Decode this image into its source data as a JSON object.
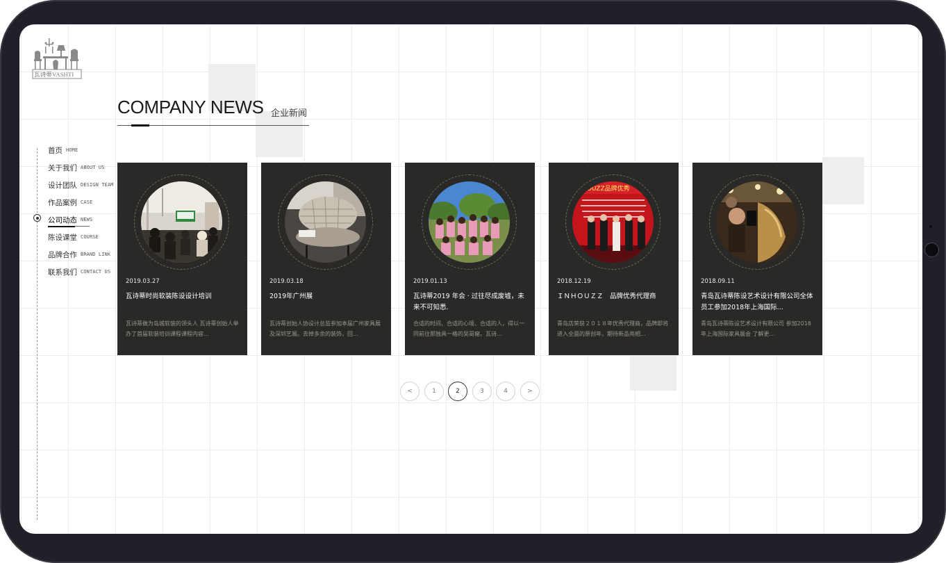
{
  "logo": {
    "brand_cn": "瓦诗蒂",
    "brand_en": "VASHTI"
  },
  "nav": {
    "items": [
      {
        "cn": "首页",
        "en": "HOME"
      },
      {
        "cn": "关于我们",
        "en": "ABOUT US"
      },
      {
        "cn": "设计团队",
        "en": "DESIGN TEAM"
      },
      {
        "cn": "作品案例",
        "en": "CASE"
      },
      {
        "cn": "公司动态",
        "en": "NEWS"
      },
      {
        "cn": "陈设课堂",
        "en": "COURSE"
      },
      {
        "cn": "品牌合作",
        "en": "BRAND LINK"
      },
      {
        "cn": "联系我们",
        "en": "CONTACT US"
      }
    ],
    "active_index": 4
  },
  "section": {
    "title_en": "COMPANY NEWS",
    "title_cn": "企业新闻"
  },
  "news": [
    {
      "date": "2019.03.27",
      "title": "瓦诗蒂时尚软装陈设设计培训",
      "desc": "瓦诗蒂做为岛城软装的领头人 瓦诗蒂创始人举办了首届软装培训课程课程内容...",
      "photo": "training-room-photo"
    },
    {
      "date": "2019.03.18",
      "title": "2019年广州展",
      "desc": "瓦诗蒂创始人协设计总监参加本届广州家具展及深圳艺展。去掉多余的装饰，回...",
      "photo": "furniture-chair-photo"
    },
    {
      "date": "2019.01.13",
      "title": "瓦诗蒂2019 年会 · 过往尽成废墟，未来不可知悉.",
      "desc": "合适的时间、合适的心境、合适的人，得以一同前往那独具一格的吴哥窟。瓦诗...",
      "photo": "team-group-photo"
    },
    {
      "date": "2018.12.19",
      "title": "ＩＮＨＯＵＺＺ　品牌优秀代理商",
      "desc": "青岛店荣获２０１８年优秀代理商，品牌即将进入全面的原创年，期待新品亮相...",
      "photo": "award-ceremony-photo",
      "photo_banner": "HOUZZ品牌优秀"
    },
    {
      "date": "2018.09.11",
      "title": "青岛瓦诗蒂陈设艺术设计有限公司全体员工参加2018年上海国际...",
      "desc": "青岛瓦诗蒂陈设艺术设计有限公司 参加2018年上海国际家具展会 了解更...",
      "photo": "fair-selfie-photo"
    }
  ],
  "pagination": {
    "prev": "<",
    "pages": [
      "1",
      "2",
      "3",
      "4"
    ],
    "current": "2",
    "next": ">"
  }
}
